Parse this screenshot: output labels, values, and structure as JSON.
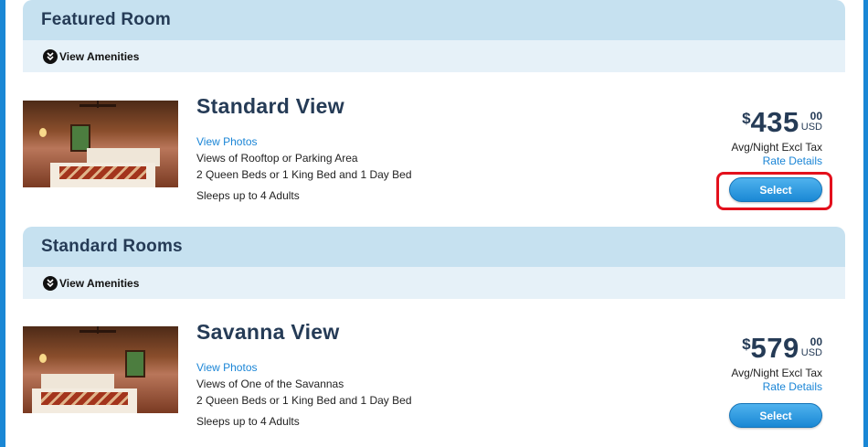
{
  "featured": {
    "title": "Featured Room",
    "amenities_label": "View Amenities",
    "room": {
      "name": "Standard View",
      "view_photos": "View Photos",
      "view_desc": "Views of Rooftop or Parking Area",
      "beds": "2 Queen Beds or 1 King Bed and 1 Day Bed",
      "sleeps": "Sleeps up to 4 Adults",
      "price_symbol": "$",
      "price_whole": "435",
      "price_cents": "00",
      "currency": "USD",
      "avg_night": "Avg/Night Excl Tax",
      "rate_details": "Rate Details",
      "select_label": "Select",
      "select_highlighted": true
    }
  },
  "standard": {
    "title": "Standard Rooms",
    "amenities_label": "View Amenities",
    "room": {
      "name": "Savanna View",
      "view_photos": "View Photos",
      "view_desc": "Views of One of the Savannas",
      "beds": "2 Queen Beds or 1 King Bed and 1 Day Bed",
      "sleeps": "Sleeps up to 4 Adults",
      "price_symbol": "$",
      "price_whole": "579",
      "price_cents": "00",
      "currency": "USD",
      "avg_night": "Avg/Night Excl Tax",
      "rate_details": "Rate Details",
      "select_label": "Select"
    }
  },
  "colors": {
    "frame": "#1a87d5",
    "header_bg": "#c6e1f0",
    "amenities_bg": "#e6f1f8",
    "title_text": "#253b56",
    "link": "#1a85d6",
    "button": "#1a88d4",
    "highlight": "#e3101c"
  }
}
